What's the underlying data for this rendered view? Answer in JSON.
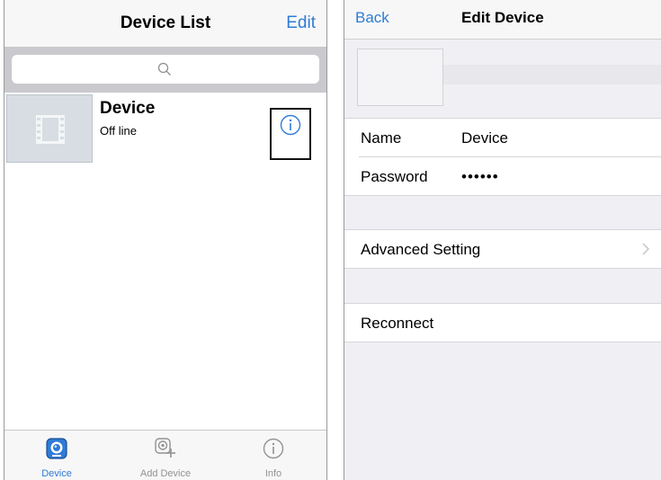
{
  "left_screen": {
    "title": "Device List",
    "edit_label": "Edit",
    "device": {
      "name": "Device",
      "status": "Off line"
    },
    "tabs": [
      {
        "label": "Device",
        "icon": "camera-icon",
        "active": true
      },
      {
        "label": "Add Device",
        "icon": "add-camera-icon",
        "active": false
      },
      {
        "label": "Info",
        "icon": "info-icon",
        "active": false
      }
    ]
  },
  "right_screen": {
    "back_label": "Back",
    "title": "Edit Device",
    "name_label": "Name",
    "name_value": "Device",
    "password_label": "Password",
    "password_value": "••••••",
    "advanced_label": "Advanced Setting",
    "reconnect_label": "Reconnect"
  },
  "colors": {
    "accent": "#2f7bd6",
    "nav_bg": "#f7f7f7",
    "search_bg": "#c9c9ce",
    "group_bg": "#efeff4",
    "inactive_tab": "#929292"
  }
}
